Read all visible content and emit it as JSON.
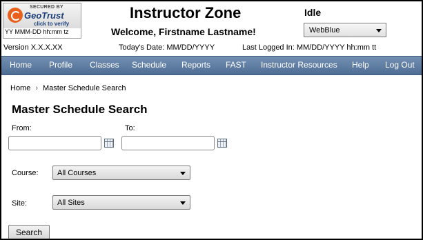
{
  "seal": {
    "secured_text": "SECURED BY",
    "brand": "GeoTrust",
    "verify_text": "click to verify",
    "timestamp": "YY MMM-DD hh:mm tz"
  },
  "header": {
    "title": "Instructor Zone",
    "welcome": "Welcome, Firstname Lastname!",
    "status": "Idle",
    "theme": "WebBlue"
  },
  "info": {
    "version": "Version X.X.X.XX",
    "todays_date": "Today's Date: MM/DD/YYYY",
    "last_logged_in": "Last Logged In: MM/DD/YYYY hh:mm tt"
  },
  "nav": {
    "items": [
      "Home",
      "Profile",
      "Classes",
      "Schedule",
      "Reports",
      "FAST",
      "Instructor Resources",
      "Help",
      "Log Out"
    ]
  },
  "breadcrumb": {
    "home": "Home",
    "separator": "›",
    "current": "Master Schedule Search"
  },
  "page": {
    "title": "Master Schedule Search",
    "from_label": "From:",
    "to_label": "To:",
    "from_value": "",
    "to_value": "",
    "course_label": "Course:",
    "course_value": "All Courses",
    "site_label": "Site:",
    "site_value": "All Sites",
    "search_button": "Search"
  },
  "colors": {
    "nav_top": "#7390b3",
    "nav_bottom": "#4f6d94",
    "brand": "#1d3f7a",
    "logo_accent": "#e8601c"
  },
  "icons": {
    "calendar": "calendar-icon",
    "dropdown": "chevron-down-icon"
  }
}
